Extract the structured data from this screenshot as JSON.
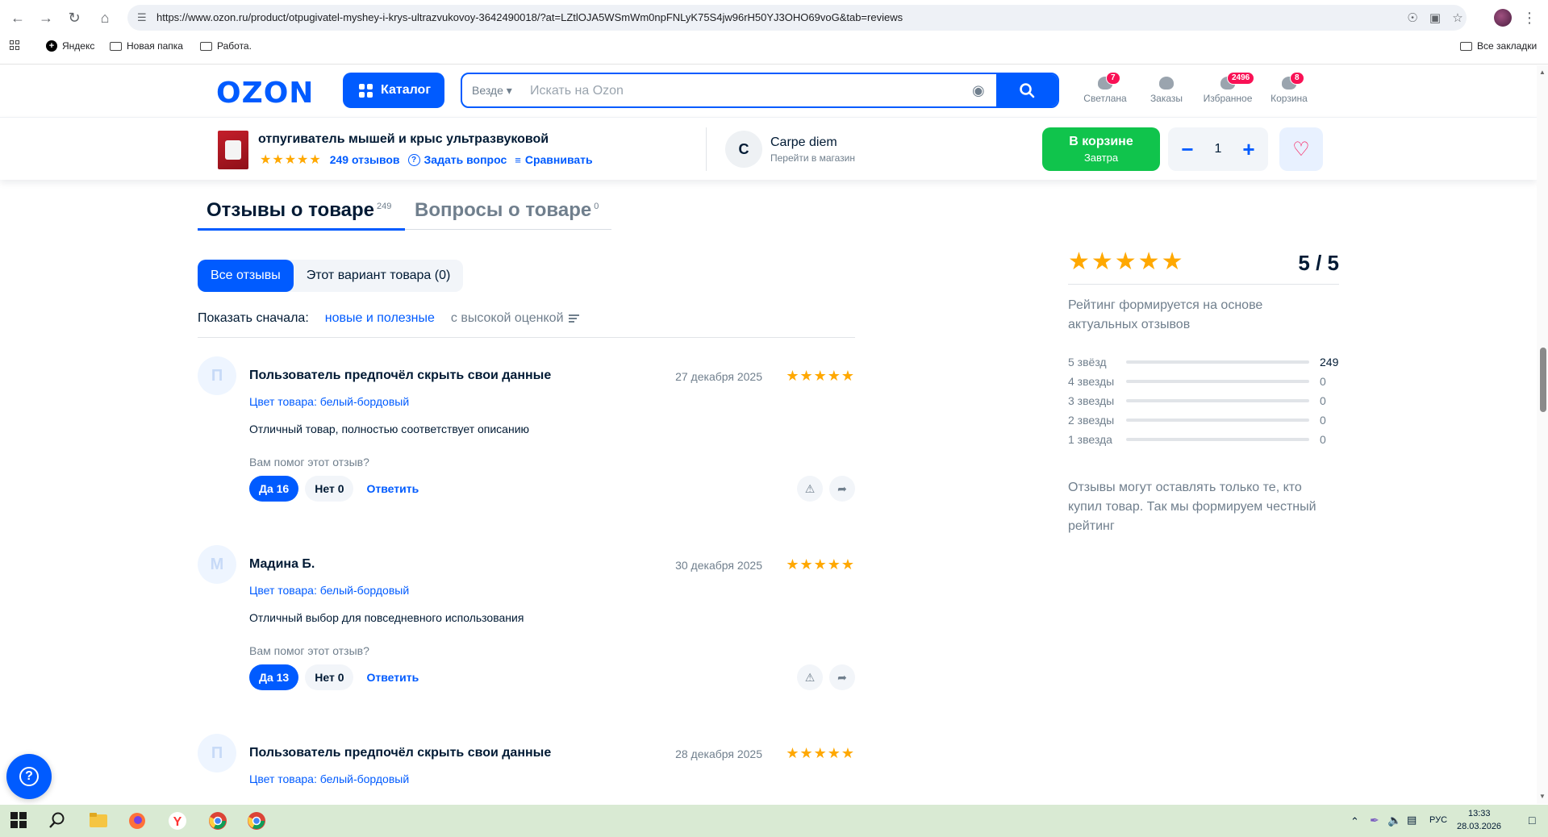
{
  "browser": {
    "url": "https://www.ozon.ru/product/otpugivatel-myshey-i-krys-ultrazvukovoy-3642490018/?at=LZtlOJA5WSmWm0npFNLyK75S4jw96rH50YJ3OHO69voG&tab=reviews",
    "bookmarks": [
      "Яндекс",
      "Новая папка",
      "Работа."
    ],
    "all_bookmarks": "Все закладки"
  },
  "header": {
    "logo": "OZON",
    "catalog": "Каталог",
    "search_scope": "Везде",
    "search_placeholder": "Искать на Ozon",
    "items": [
      {
        "label": "Светлана",
        "badge": "7"
      },
      {
        "label": "Заказы",
        "badge": ""
      },
      {
        "label": "Избранное",
        "badge": "2496"
      },
      {
        "label": "Корзина",
        "badge": "8"
      }
    ]
  },
  "product": {
    "title": "отпугиватель мышей и крыс ультразвуковой",
    "rating_stars": "★★★★★",
    "reviews_link": "249 отзывов",
    "ask": "Задать вопрос",
    "compare": "Сравнивать",
    "seller_initial": "C",
    "seller_name": "Carpe diem",
    "seller_sub": "Перейти в магазин",
    "cart_label": "В корзине",
    "cart_sub": "Завтра",
    "qty_minus": "−",
    "quantity": "1",
    "qty_plus": "+"
  },
  "tabs": [
    {
      "label": "Отзывы о товаре",
      "count": "249"
    },
    {
      "label": "Вопросы о товаре",
      "count": "0"
    }
  ],
  "filters": {
    "all": "Все отзывы",
    "variant": "Этот вариант товара (0)"
  },
  "sort": {
    "label": "Показать сначала:",
    "active": "новые и полезные",
    "other": "с высокой оценкой"
  },
  "reviews": [
    {
      "initial": "П",
      "author": "Пользователь предпочёл скрыть свои данные",
      "date": "27 декабря 2025",
      "stars": "★★★★★",
      "color": "Цвет товара: белый-бордовый",
      "text": "Отличный товар, полностью соответствует описанию",
      "helpful_q": "Вам помог этот отзыв?",
      "yes": "Да 16",
      "no": "Нет 0",
      "reply": "Ответить"
    },
    {
      "initial": "М",
      "author": "Мадина Б.",
      "date": "30 декабря 2025",
      "stars": "★★★★★",
      "color": "Цвет товара: белый-бордовый",
      "text": "Отличный выбор для повседневного использования",
      "helpful_q": "Вам помог этот отзыв?",
      "yes": "Да 13",
      "no": "Нет 0",
      "reply": "Ответить"
    },
    {
      "initial": "П",
      "author": "Пользователь предпочёл скрыть свои данные",
      "date": "28 декабря 2025",
      "stars": "★★★★★",
      "color": "Цвет товара: белый-бордовый"
    }
  ],
  "rating": {
    "stars": "★★★★★",
    "score": "5 / 5",
    "note": "Рейтинг формируется на основе актуальных отзывов",
    "distribution": [
      {
        "label": "5 звёзд",
        "count": "249",
        "fraction": 1.0
      },
      {
        "label": "4 звезды",
        "count": "0",
        "fraction": 0
      },
      {
        "label": "3 звезды",
        "count": "0",
        "fraction": 0
      },
      {
        "label": "2 звезды",
        "count": "0",
        "fraction": 0
      },
      {
        "label": "1 звезда",
        "count": "0",
        "fraction": 0
      }
    ],
    "note2": "Отзывы могут оставлять только те, кто купил товар. Так мы формируем честный рейтинг"
  },
  "taskbar": {
    "lang": "РУС",
    "time": "13:33",
    "date": "28.03.2026"
  },
  "colors": {
    "brand": "#005bff",
    "star": "#ffa800",
    "cart": "#10c44c",
    "badge": "#f91155"
  }
}
